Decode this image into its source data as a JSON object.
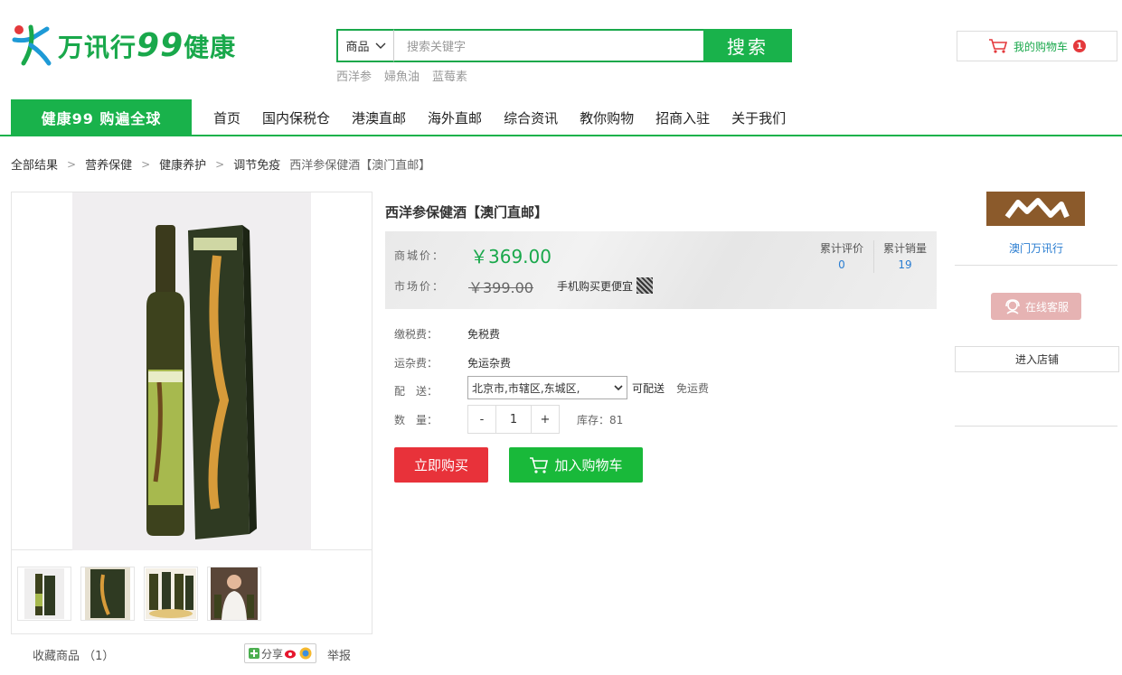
{
  "header": {
    "logo_text": "万讯行",
    "logo_num": "99",
    "logo_suffix": "健康",
    "search_category": "商品",
    "search_placeholder": "搜索关键字",
    "search_button": "搜索",
    "hot_words": [
      "西洋参",
      "婦魚油",
      "蓝莓素"
    ],
    "cart_label": "我的购物车",
    "cart_count": "1"
  },
  "nav": {
    "slogan": "健康99 购遍全球",
    "links": [
      "首页",
      "国内保税仓",
      "港澳直邮",
      "海外直邮",
      "综合资讯",
      "教你购物",
      "招商入驻",
      "关于我们"
    ]
  },
  "breadcrumb": {
    "items": [
      "全部结果",
      "营养保健",
      "健康养护",
      "调节免疫"
    ],
    "current": "西洋参保健酒【澳门直邮】"
  },
  "product": {
    "title": "西洋参保健酒【澳门直邮】",
    "price_label": "商城价：",
    "price": "￥369.00",
    "market_label": "市场价：",
    "market_price": "￥399.00",
    "mobile_text": "手机购买更便宜",
    "review_label": "累计评价",
    "review_count": "0",
    "sales_label": "累计销量",
    "sales_count": "19",
    "tax_label": "缴税费：",
    "tax_value": "免税费",
    "shipping_label": "运杂费：",
    "shipping_value": "免运杂费",
    "delivery_label": "配　送：",
    "delivery_address": "北京市,市辖区,东城区,",
    "delivery_status": "可配送",
    "delivery_fee": "免运费",
    "qty_label": "数　量：",
    "qty_minus": "-",
    "qty_value": "1",
    "qty_plus": "+",
    "stock": "库存：81",
    "buy_now": "立即购买",
    "add_cart": "加入购物车"
  },
  "gallery": {
    "favorite": "收藏商品 （1）",
    "share": "分享",
    "report": "举报"
  },
  "shop": {
    "name": "澳门万讯行",
    "service": "在线客服",
    "enter": "进入店铺"
  },
  "colors": {
    "brand_green": "#19b24b",
    "price_green": "#19a84b",
    "buy_red": "#e8323a",
    "link_blue": "#2a7dd1"
  }
}
